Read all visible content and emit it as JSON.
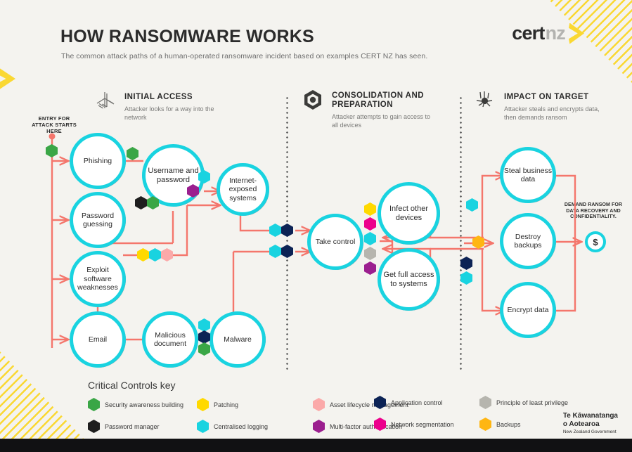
{
  "header": {
    "title": "HOW RANSOMWARE WORKS",
    "subtitle": "The common attack paths of a human-operated ransomware incident based on examples CERT NZ has seen.",
    "logo_cert": "cert",
    "logo_nz": "nz"
  },
  "sections": [
    {
      "title": "INITIAL ACCESS",
      "desc": "Attacker looks for a way into the network",
      "icon": "layers-icon"
    },
    {
      "title": "CONSOLIDATION AND PREPARATION",
      "desc": "Attacker attempts to gain access to all devices",
      "icon": "hexagon-core-icon"
    },
    {
      "title": "IMPACT ON TARGET",
      "desc": "Attacker steals and encrypts data, then demands ransom",
      "icon": "impact-burst-icon"
    }
  ],
  "entry_label": "ENTRY FOR ATTACK STARTS HERE",
  "ransom_label": "DEMAND RANSOM FOR DATA RECOVERY AND CONFIDENTIALITY.",
  "dollar_symbol": "$",
  "nodes": [
    {
      "id": "phishing",
      "label": "Phishing"
    },
    {
      "id": "password-guessing",
      "label": "Password guessing"
    },
    {
      "id": "exploit-software-weaknesses",
      "label": "Exploit software weaknesses"
    },
    {
      "id": "email",
      "label": "Email"
    },
    {
      "id": "username-and-password",
      "label": "Username and password"
    },
    {
      "id": "malicious-document",
      "label": "Malicious document"
    },
    {
      "id": "internet-exposed-systems",
      "label": "Internet-exposed systems"
    },
    {
      "id": "malware",
      "label": "Malware"
    },
    {
      "id": "take-control",
      "label": "Take control"
    },
    {
      "id": "infect-other-devices",
      "label": "Infect other devices"
    },
    {
      "id": "get-full-access-to-systems",
      "label": "Get full access to systems"
    },
    {
      "id": "steal-business-data",
      "label": "Steal business data"
    },
    {
      "id": "destroy-backups",
      "label": "Destroy backups"
    },
    {
      "id": "encrypt-data",
      "label": "Encrypt data"
    }
  ],
  "legend": {
    "title": "Critical Controls key",
    "items": [
      {
        "label": "Security awareness building",
        "color": "#3AA646"
      },
      {
        "label": "Patching",
        "color": "#FFD900"
      },
      {
        "label": "Asset lifecycle management",
        "color": "#FBA9A9"
      },
      {
        "label": "Password manager",
        "color": "#1E1E1E"
      },
      {
        "label": "Centralised logging",
        "color": "#19D3E0"
      },
      {
        "label": "Multi-factor authentication",
        "color": "#9B1F8F"
      },
      {
        "label": "Application control",
        "color": "#0C2355"
      },
      {
        "label": "Principle of least privilege",
        "color": "#B6B5AE"
      },
      {
        "label": "Network segmentation",
        "color": "#EC008C"
      },
      {
        "label": "Backups",
        "color": "#FFB612"
      }
    ]
  },
  "footer": {
    "govt_line1": "Te Kāwanatanga",
    "govt_line2": "o Aotearoa",
    "govt_line3": "New Zealand Government"
  },
  "colors": {
    "background": "#f4f3ef",
    "node_ring": "#19D3E0",
    "flow_line": "#F4766C",
    "accent_yellow": "#FAD832",
    "text_dark": "#2b2b2b"
  }
}
